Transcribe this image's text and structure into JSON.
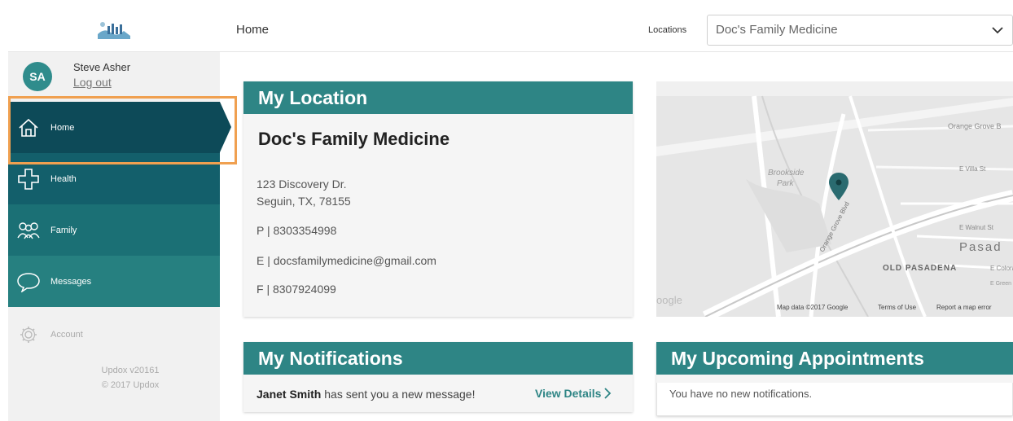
{
  "header": {
    "page_title": "Home",
    "locations_label": "Locations",
    "location_selected": "Doc's Family Medicine"
  },
  "user": {
    "initials": "SA",
    "name": "Steve Asher",
    "logout": "Log out"
  },
  "nav": {
    "items": [
      {
        "label": "Home",
        "icon": "home-icon",
        "selected": true
      },
      {
        "label": "Health",
        "icon": "health-cross-icon"
      },
      {
        "label": "Family",
        "icon": "family-icon"
      },
      {
        "label": "Messages",
        "icon": "speech-bubble-icon"
      }
    ],
    "account": "Account",
    "version": "Updox v20161",
    "copyright": "© 2017 Updox"
  },
  "location_card": {
    "title": "My Location",
    "name": "Doc's Family Medicine",
    "address_line1": "123 Discovery Dr.",
    "address_line2": "Seguin, TX, 78155",
    "phone": "P | 8303354998",
    "email": "E | docsfamilymedicine@gmail.com",
    "fax": "F | 8307924099"
  },
  "map": {
    "labels": {
      "brookside": "Brookside",
      "park": "Park",
      "orange_grove_blvd_top": "Orange Grove B",
      "orange_grove_blvd_road": "Orange Grove Blvd",
      "e_villa": "E Villa St",
      "e_walnut": "E Walnut St",
      "pasadena": "Pasad",
      "old_pasadena": "OLD PASADENA",
      "e_colorado": "E Colora",
      "e_green": "E Green",
      "google": "oogle"
    },
    "footer": {
      "map_data": "Map data ©2017 Google",
      "terms": "Terms of Use",
      "report": "Report a map error"
    }
  },
  "notifications_card": {
    "title": "My Notifications",
    "sender": "Janet Smith",
    "message": " has sent you a new message!",
    "view_details": "View Details"
  },
  "appointments_card": {
    "title": "My Upcoming Appointments",
    "empty_text": "You have no new notifications."
  },
  "colors": {
    "teal": "#2e8585",
    "nav_home": "#0d4a58",
    "highlight": "#f0a050"
  }
}
